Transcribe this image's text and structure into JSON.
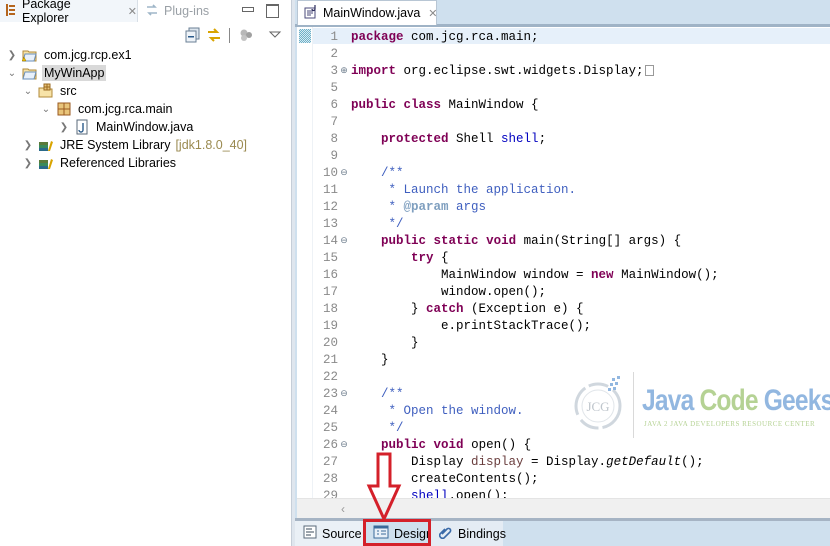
{
  "left_pane": {
    "tabs": [
      {
        "label": "Package Explorer",
        "icon": "package-explorer-icon",
        "active": true
      },
      {
        "label": "Plug-ins",
        "icon": "plugins-icon",
        "active": false
      }
    ],
    "tree": [
      {
        "label": "com.jcg.rcp.ex1",
        "icon": "project-warning-icon",
        "expanded": false,
        "level": 0
      },
      {
        "label": "MyWinApp",
        "icon": "project-icon",
        "expanded": true,
        "level": 0,
        "selected": true
      },
      {
        "label": "src",
        "icon": "source-folder-icon",
        "expanded": true,
        "level": 1
      },
      {
        "label": "com.jcg.rca.main",
        "icon": "package-icon",
        "expanded": true,
        "level": 2
      },
      {
        "label": "MainWindow.java",
        "icon": "java-file-icon",
        "expanded": false,
        "level": 3
      },
      {
        "label": "JRE System Library",
        "decoration": "[jdk1.8.0_40]",
        "icon": "library-icon",
        "expanded": false,
        "level": 1
      },
      {
        "label": "Referenced Libraries",
        "icon": "library-icon",
        "expanded": false,
        "level": 1
      }
    ]
  },
  "editor": {
    "tab": {
      "label": "MainWindow.java",
      "icon": "java-editor-icon"
    },
    "lines": [
      {
        "n": "1",
        "fold": "",
        "text": "package com.jcg.rca.main;"
      },
      {
        "n": "2",
        "fold": "",
        "text": ""
      },
      {
        "n": "3",
        "fold": "expand",
        "text": "import org.eclipse.swt.widgets.Display;"
      },
      {
        "n": "5",
        "fold": "",
        "text": ""
      },
      {
        "n": "6",
        "fold": "",
        "text": "public class MainWindow {"
      },
      {
        "n": "7",
        "fold": "",
        "text": ""
      },
      {
        "n": "8",
        "fold": "",
        "text": "    protected Shell shell;"
      },
      {
        "n": "9",
        "fold": "",
        "text": ""
      },
      {
        "n": "10",
        "fold": "collapse",
        "text": "    /**"
      },
      {
        "n": "11",
        "fold": "",
        "text": "     * Launch the application."
      },
      {
        "n": "12",
        "fold": "",
        "text": "     * @param args"
      },
      {
        "n": "13",
        "fold": "",
        "text": "     */"
      },
      {
        "n": "14",
        "fold": "collapse",
        "text": "    public static void main(String[] args) {"
      },
      {
        "n": "15",
        "fold": "",
        "text": "        try {"
      },
      {
        "n": "16",
        "fold": "",
        "text": "            MainWindow window = new MainWindow();"
      },
      {
        "n": "17",
        "fold": "",
        "text": "            window.open();"
      },
      {
        "n": "18",
        "fold": "",
        "text": "        } catch (Exception e) {"
      },
      {
        "n": "19",
        "fold": "",
        "text": "            e.printStackTrace();"
      },
      {
        "n": "20",
        "fold": "",
        "text": "        }"
      },
      {
        "n": "21",
        "fold": "",
        "text": "    }"
      },
      {
        "n": "22",
        "fold": "",
        "text": ""
      },
      {
        "n": "23",
        "fold": "collapse",
        "text": "    /**"
      },
      {
        "n": "24",
        "fold": "",
        "text": "     * Open the window."
      },
      {
        "n": "25",
        "fold": "",
        "text": "     */"
      },
      {
        "n": "26",
        "fold": "collapse",
        "text": "    public void open() {"
      },
      {
        "n": "27",
        "fold": "",
        "text": "        Display display = Display.getDefault();"
      },
      {
        "n": "28",
        "fold": "",
        "text": "        createContents();"
      },
      {
        "n": "29",
        "fold": "",
        "text": "        shell.open();"
      }
    ],
    "bottom_tabs": [
      {
        "label": "Source",
        "icon": "source-icon"
      },
      {
        "label": "Design",
        "icon": "design-icon",
        "highlighted": true
      },
      {
        "label": "Bindings",
        "icon": "bindings-icon"
      }
    ]
  },
  "watermark": {
    "title_java": "Java",
    "title_code": "Code",
    "title_geeks": "Geeks",
    "subtitle": "JAVA 2 JAVA DEVELOPERS RESOURCE CENTER",
    "logo_text": "JCG"
  },
  "colors": {
    "keyword": "#7f0055",
    "field": "#0000c0",
    "comment": "#3f5fbf",
    "annotation_red": "#d4202a",
    "chrome": "#cfe0ee"
  }
}
